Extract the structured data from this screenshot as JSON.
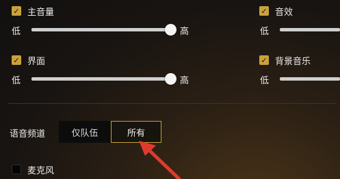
{
  "settings": {
    "master_volume": {
      "label": "主音量",
      "checked": true,
      "min_label": "低",
      "max_label": "高",
      "level": 1.0
    },
    "sfx": {
      "label": "音效",
      "checked": true,
      "min_label": "低"
    },
    "interface": {
      "label": "界面",
      "checked": true,
      "min_label": "低",
      "max_label": "高",
      "level": 1.0
    },
    "bgm": {
      "label": "背景音乐",
      "checked": true,
      "min_label": "低"
    }
  },
  "voice_channel": {
    "label": "语音频道",
    "options": [
      "仅队伍",
      "所有"
    ],
    "selected": "所有"
  },
  "microphone": {
    "label": "麦克风",
    "checked": false
  },
  "colors": {
    "accent": "#c9a23c",
    "annotation_arrow": "#e03a2e"
  }
}
